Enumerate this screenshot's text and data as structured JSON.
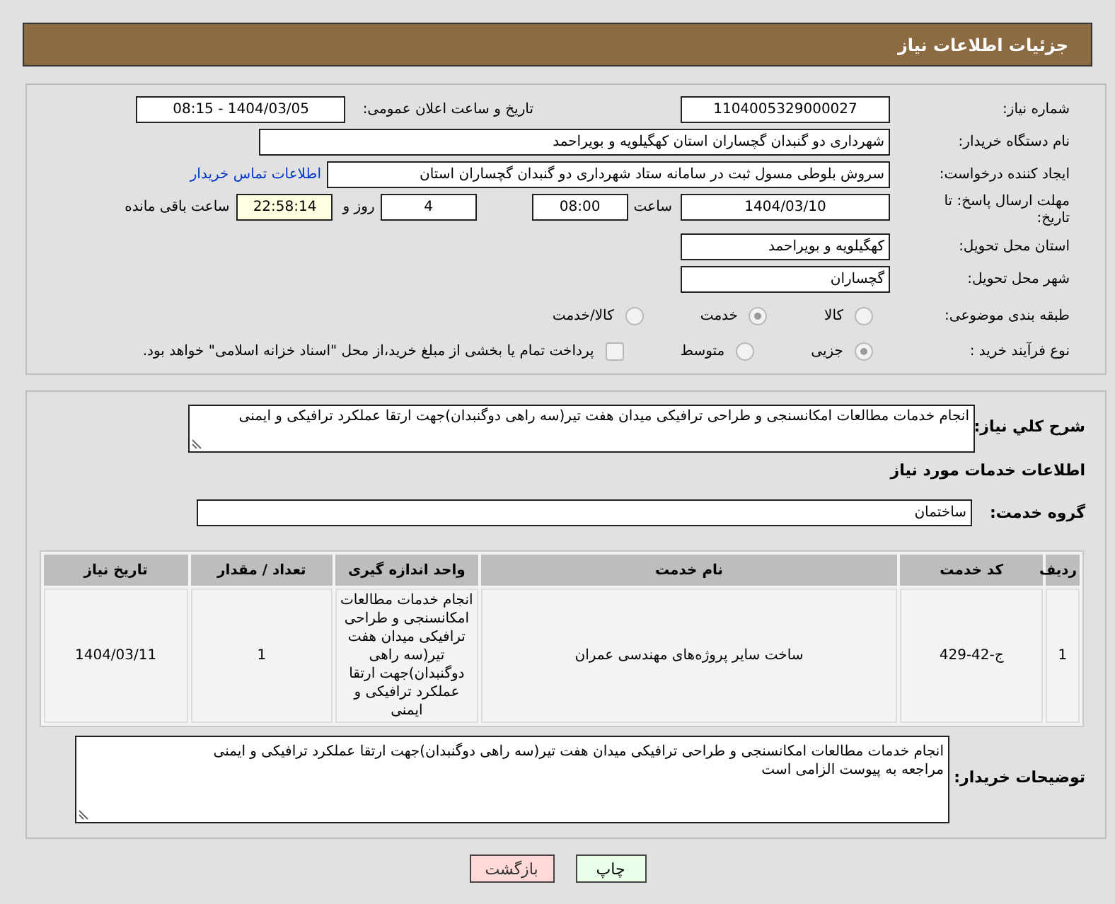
{
  "header": {
    "title": "جزئیات اطلاعات نیاز"
  },
  "details": {
    "need_number": {
      "label": "شماره نیاز:",
      "value": "1104005329000027"
    },
    "announce_datetime": {
      "label": "تاریخ و ساعت اعلان عمومی:",
      "value": "1404/03/05 - 08:15"
    },
    "buyer_org": {
      "label": "نام دستگاه خریدار:",
      "value": "شهرداری دو گنبدان گچساران استان کهگیلویه و بویراحمد"
    },
    "creator": {
      "label": "ایجاد کننده درخواست:",
      "value": "سروش بلوطی مسول ثبت در سامانه ستاد شهرداری دو گنبدان گچساران استان",
      "link": "اطلاعات تماس خریدار"
    },
    "deadline": {
      "label": "مهلت ارسال پاسخ: تا تاریخ:",
      "date": "1404/03/10",
      "time_label": "ساعت",
      "time": "08:00",
      "days": "4",
      "days_label": "روز و",
      "remaining": "22:58:14",
      "remaining_label": "ساعت باقی مانده"
    },
    "province": {
      "label": "استان محل تحویل:",
      "value": "کهگیلویه و بویراحمد"
    },
    "city": {
      "label": "شهر محل تحویل:",
      "value": "گچساران"
    },
    "category": {
      "label": "طبقه بندی موضوعی:",
      "options": [
        {
          "label": "کالا",
          "selected": false
        },
        {
          "label": "خدمت",
          "selected": true
        },
        {
          "label": "کالا/خدمت",
          "selected": false
        }
      ]
    },
    "purchase_type": {
      "label": "نوع فرآیند خرید :",
      "options": [
        {
          "label": "جزیی",
          "selected": true
        },
        {
          "label": "متوسط",
          "selected": false
        }
      ],
      "treasury_payment": {
        "checked": false,
        "label": "پرداخت تمام یا بخشی از مبلغ خرید،از محل \"اسناد خزانه اسلامی\" خواهد بود."
      }
    }
  },
  "need": {
    "summary": {
      "label": "شرح کلي نیاز:",
      "value": "انجام خدمات مطالعات امکانسنجی و طراحی ترافیکی میدان هفت تیر(سه راهی دوگنبدان)جهت ارتقا عملکرد ترافیکی و ایمنی"
    },
    "services_title": "اطلاعات خدمات مورد نیاز",
    "service_group": {
      "label": "گروه خدمت:",
      "value": "ساختمان"
    },
    "table": {
      "columns": [
        "ردیف",
        "کد خدمت",
        "نام خدمت",
        "واحد اندازه گیری",
        "تعداد / مقدار",
        "تاریخ نیاز"
      ],
      "rows": [
        {
          "cells": [
            "1",
            "ج-42-429",
            "ساخت سایر پروژه‌های مهندسی عمران",
            "انجام خدمات مطالعات امکانسنجی و طراحی ترافیکی میدان هفت تیر(سه راهی دوگنبدان)جهت ارتقا عملکرد ترافیکی و ایمنی",
            "1",
            "1404/03/11"
          ]
        }
      ]
    },
    "buyer_notes": {
      "label": "توضیحات خریدار:",
      "lines": [
        "انجام خدمات مطالعات امکانسنجی و طراحی ترافیکی میدان هفت تیر(سه راهی دوگنبدان)جهت ارتقا عملکرد ترافیکی و ایمنی",
        "مراجعه به پیوست الزامی است"
      ]
    }
  },
  "buttons": [
    {
      "kind": "print",
      "label": "چاپ"
    },
    {
      "kind": "back",
      "label": "بازگشت"
    }
  ]
}
